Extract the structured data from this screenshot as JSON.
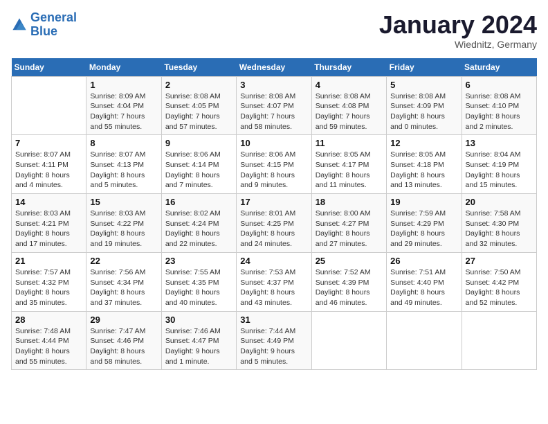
{
  "header": {
    "logo_line1": "General",
    "logo_line2": "Blue",
    "month": "January 2024",
    "location": "Wiednitz, Germany"
  },
  "days_of_week": [
    "Sunday",
    "Monday",
    "Tuesday",
    "Wednesday",
    "Thursday",
    "Friday",
    "Saturday"
  ],
  "weeks": [
    [
      {
        "day": "",
        "info": ""
      },
      {
        "day": "1",
        "info": "Sunrise: 8:09 AM\nSunset: 4:04 PM\nDaylight: 7 hours\nand 55 minutes."
      },
      {
        "day": "2",
        "info": "Sunrise: 8:08 AM\nSunset: 4:05 PM\nDaylight: 7 hours\nand 57 minutes."
      },
      {
        "day": "3",
        "info": "Sunrise: 8:08 AM\nSunset: 4:07 PM\nDaylight: 7 hours\nand 58 minutes."
      },
      {
        "day": "4",
        "info": "Sunrise: 8:08 AM\nSunset: 4:08 PM\nDaylight: 7 hours\nand 59 minutes."
      },
      {
        "day": "5",
        "info": "Sunrise: 8:08 AM\nSunset: 4:09 PM\nDaylight: 8 hours\nand 0 minutes."
      },
      {
        "day": "6",
        "info": "Sunrise: 8:08 AM\nSunset: 4:10 PM\nDaylight: 8 hours\nand 2 minutes."
      }
    ],
    [
      {
        "day": "7",
        "info": "Sunrise: 8:07 AM\nSunset: 4:11 PM\nDaylight: 8 hours\nand 4 minutes."
      },
      {
        "day": "8",
        "info": "Sunrise: 8:07 AM\nSunset: 4:13 PM\nDaylight: 8 hours\nand 5 minutes."
      },
      {
        "day": "9",
        "info": "Sunrise: 8:06 AM\nSunset: 4:14 PM\nDaylight: 8 hours\nand 7 minutes."
      },
      {
        "day": "10",
        "info": "Sunrise: 8:06 AM\nSunset: 4:15 PM\nDaylight: 8 hours\nand 9 minutes."
      },
      {
        "day": "11",
        "info": "Sunrise: 8:05 AM\nSunset: 4:17 PM\nDaylight: 8 hours\nand 11 minutes."
      },
      {
        "day": "12",
        "info": "Sunrise: 8:05 AM\nSunset: 4:18 PM\nDaylight: 8 hours\nand 13 minutes."
      },
      {
        "day": "13",
        "info": "Sunrise: 8:04 AM\nSunset: 4:19 PM\nDaylight: 8 hours\nand 15 minutes."
      }
    ],
    [
      {
        "day": "14",
        "info": "Sunrise: 8:03 AM\nSunset: 4:21 PM\nDaylight: 8 hours\nand 17 minutes."
      },
      {
        "day": "15",
        "info": "Sunrise: 8:03 AM\nSunset: 4:22 PM\nDaylight: 8 hours\nand 19 minutes."
      },
      {
        "day": "16",
        "info": "Sunrise: 8:02 AM\nSunset: 4:24 PM\nDaylight: 8 hours\nand 22 minutes."
      },
      {
        "day": "17",
        "info": "Sunrise: 8:01 AM\nSunset: 4:25 PM\nDaylight: 8 hours\nand 24 minutes."
      },
      {
        "day": "18",
        "info": "Sunrise: 8:00 AM\nSunset: 4:27 PM\nDaylight: 8 hours\nand 27 minutes."
      },
      {
        "day": "19",
        "info": "Sunrise: 7:59 AM\nSunset: 4:29 PM\nDaylight: 8 hours\nand 29 minutes."
      },
      {
        "day": "20",
        "info": "Sunrise: 7:58 AM\nSunset: 4:30 PM\nDaylight: 8 hours\nand 32 minutes."
      }
    ],
    [
      {
        "day": "21",
        "info": "Sunrise: 7:57 AM\nSunset: 4:32 PM\nDaylight: 8 hours\nand 35 minutes."
      },
      {
        "day": "22",
        "info": "Sunrise: 7:56 AM\nSunset: 4:34 PM\nDaylight: 8 hours\nand 37 minutes."
      },
      {
        "day": "23",
        "info": "Sunrise: 7:55 AM\nSunset: 4:35 PM\nDaylight: 8 hours\nand 40 minutes."
      },
      {
        "day": "24",
        "info": "Sunrise: 7:53 AM\nSunset: 4:37 PM\nDaylight: 8 hours\nand 43 minutes."
      },
      {
        "day": "25",
        "info": "Sunrise: 7:52 AM\nSunset: 4:39 PM\nDaylight: 8 hours\nand 46 minutes."
      },
      {
        "day": "26",
        "info": "Sunrise: 7:51 AM\nSunset: 4:40 PM\nDaylight: 8 hours\nand 49 minutes."
      },
      {
        "day": "27",
        "info": "Sunrise: 7:50 AM\nSunset: 4:42 PM\nDaylight: 8 hours\nand 52 minutes."
      }
    ],
    [
      {
        "day": "28",
        "info": "Sunrise: 7:48 AM\nSunset: 4:44 PM\nDaylight: 8 hours\nand 55 minutes."
      },
      {
        "day": "29",
        "info": "Sunrise: 7:47 AM\nSunset: 4:46 PM\nDaylight: 8 hours\nand 58 minutes."
      },
      {
        "day": "30",
        "info": "Sunrise: 7:46 AM\nSunset: 4:47 PM\nDaylight: 9 hours\nand 1 minute."
      },
      {
        "day": "31",
        "info": "Sunrise: 7:44 AM\nSunset: 4:49 PM\nDaylight: 9 hours\nand 5 minutes."
      },
      {
        "day": "",
        "info": ""
      },
      {
        "day": "",
        "info": ""
      },
      {
        "day": "",
        "info": ""
      }
    ]
  ]
}
